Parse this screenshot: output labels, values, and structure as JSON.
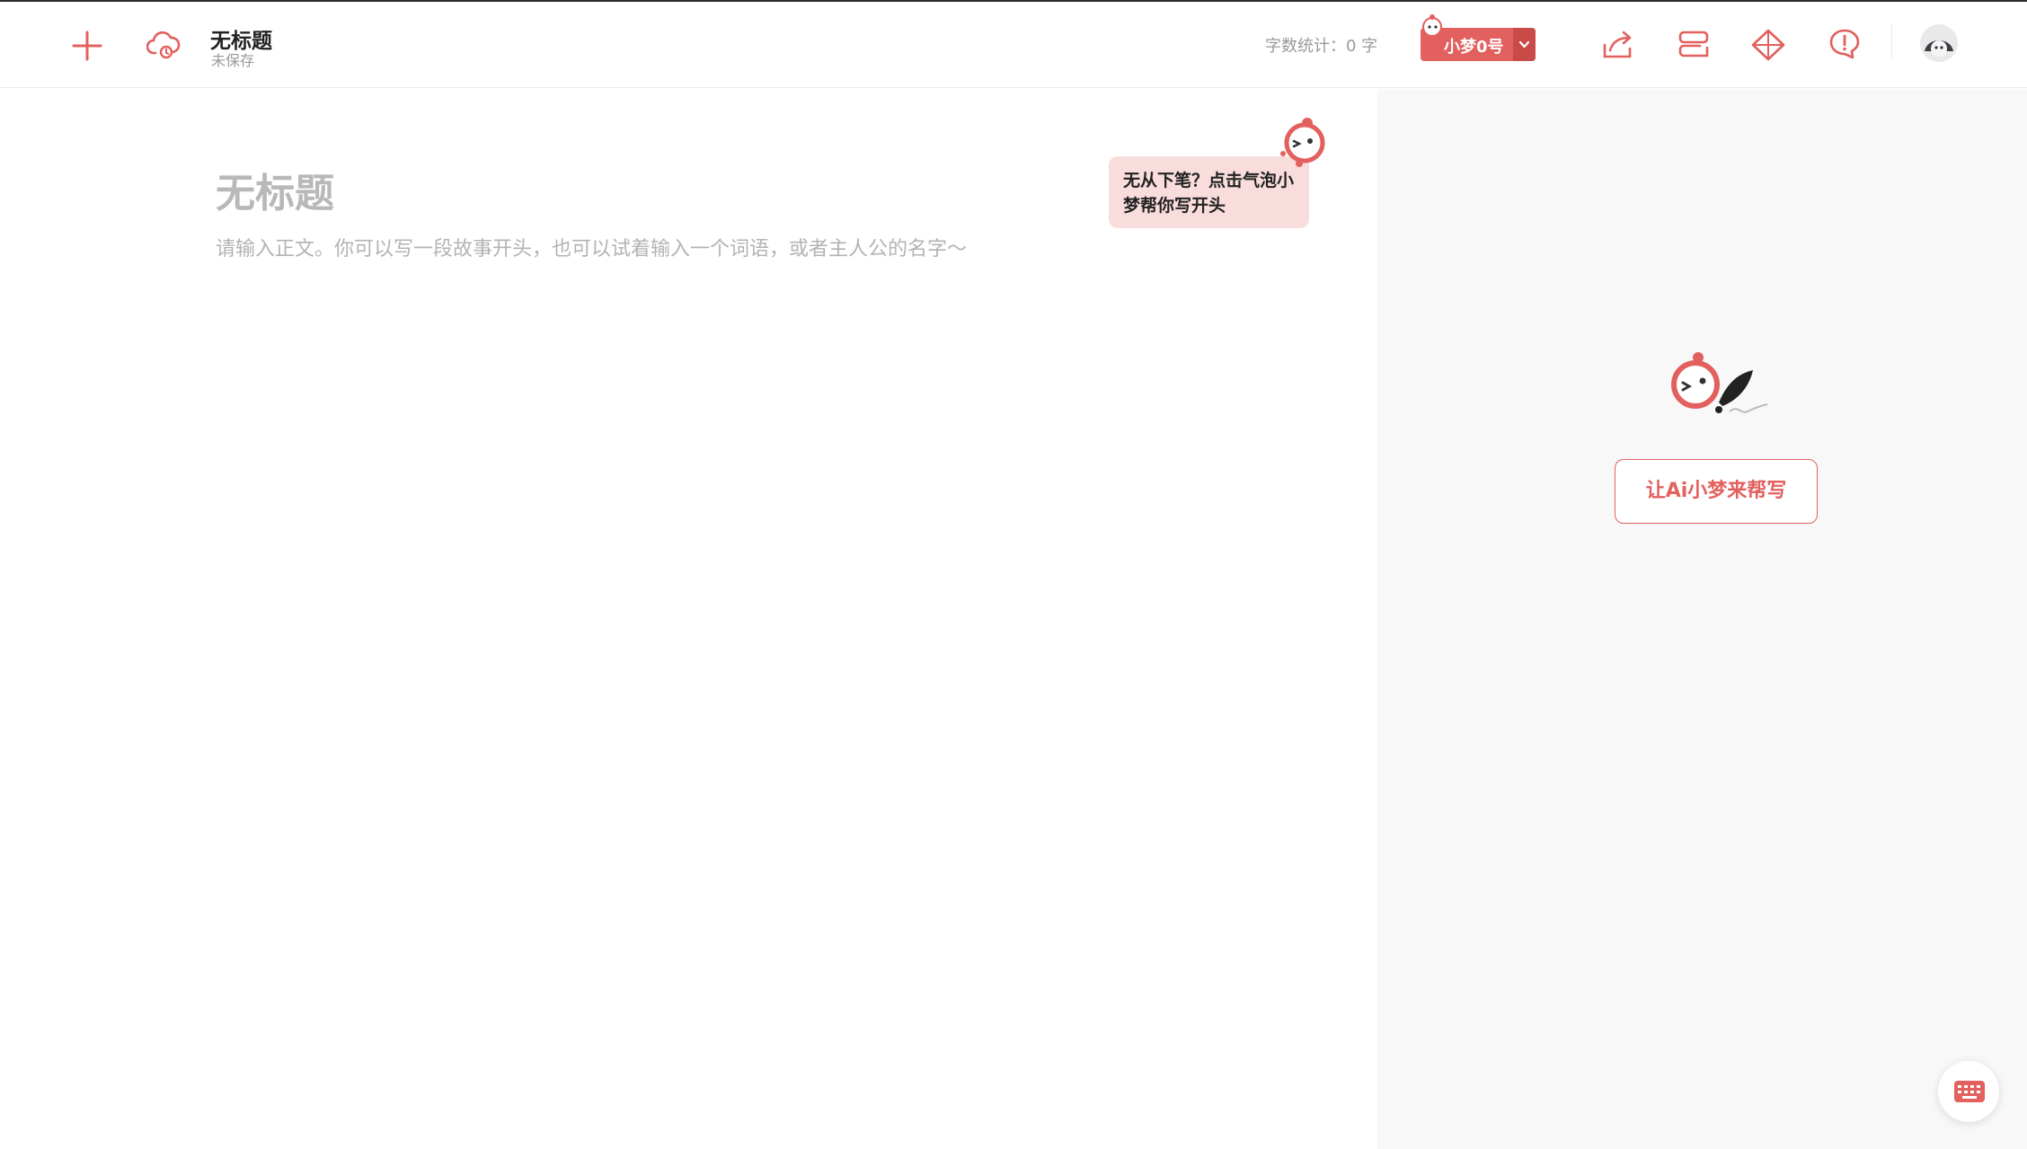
{
  "header": {
    "doc_title": "无标题",
    "doc_status": "未保存",
    "word_count_label": "字数统计：",
    "word_count_value": "0 字",
    "model_label": "小梦0号",
    "icons": [
      "plus-icon",
      "cloud-sync-icon",
      "share-icon",
      "outline-icon",
      "diamond-icon",
      "feedback-icon",
      "avatar"
    ]
  },
  "editor": {
    "title_placeholder": "无标题",
    "body_placeholder": "请输入正文。你可以写一段故事开头，也可以试着输入一个词语，或者主人公的名字～",
    "bubble_text": "无从下笔？点击气泡小梦帮你写开头"
  },
  "side_panel": {
    "help_button_label": "让Ai小梦来帮写"
  },
  "colors": {
    "accent": "#e2605d",
    "accent_dark": "#c94b48",
    "bubble_bg": "#f9dcdc",
    "panel_bg": "#f8f8f8"
  }
}
